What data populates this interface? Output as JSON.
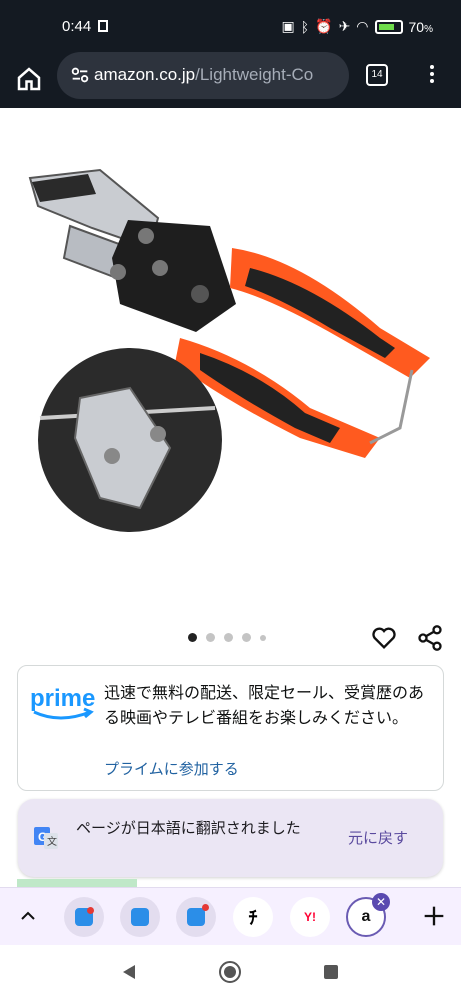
{
  "status_bar": {
    "time": "0:44",
    "battery": "70",
    "battery_unit": "%"
  },
  "toolbar": {
    "url_host": "amazon.co.jp",
    "url_path": "/Lightweight-Co",
    "tab_count": "14"
  },
  "product": {
    "image_count": 5,
    "active_index": 0
  },
  "prime": {
    "logo_text": "prime",
    "message": "迅速で無料の配送、限定セール、受賞歴のある映画やテレビ番組をお楽しみください。",
    "join_link": "プライムに参加する"
  },
  "translate": {
    "message": "ページが日本語に翻訳されました",
    "undo_label": "元に戻す"
  },
  "tab_group": {
    "tabs": [
      {
        "icon": "app-icon-blue-red"
      },
      {
        "icon": "app-icon-blue"
      },
      {
        "icon": "app-icon-blue-red"
      },
      {
        "icon": "hiragana-icon",
        "text": "ﾁ"
      },
      {
        "icon": "yahoo-icon",
        "text": "Y!"
      },
      {
        "icon": "amazon-icon",
        "text": "a"
      }
    ]
  },
  "colors": {
    "prime_blue": "#2162a1",
    "handle_orange": "#ff5a1f",
    "status_bg": "#141a22"
  }
}
